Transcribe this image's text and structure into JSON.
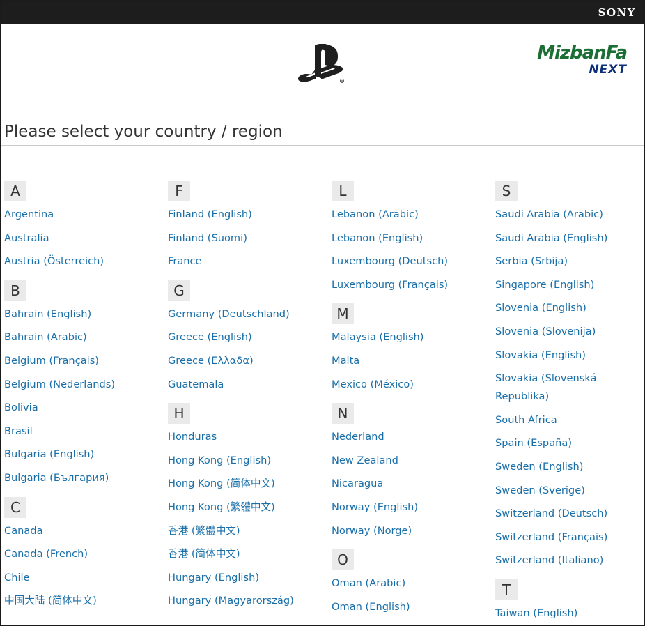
{
  "header": {
    "sony": "SONY"
  },
  "brand": {
    "line1": "MizbanFa",
    "line2": "NEXT"
  },
  "title": "Please select your country / region",
  "columns": [
    {
      "groups": [
        {
          "letter": "A",
          "items": [
            "Argentina",
            "Australia",
            "Austria (Österreich)"
          ]
        },
        {
          "letter": "B",
          "items": [
            "Bahrain (English)",
            "Bahrain (Arabic)",
            "Belgium (Français)",
            "Belgium (Nederlands)",
            "Bolivia",
            "Brasil",
            "Bulgaria (English)",
            "Bulgaria (България)"
          ]
        },
        {
          "letter": "C",
          "items": [
            "Canada",
            "Canada (French)",
            "Chile",
            "中国大陆 (简体中文)"
          ]
        }
      ]
    },
    {
      "groups": [
        {
          "letter": "F",
          "items": [
            "Finland (English)",
            "Finland (Suomi)",
            "France"
          ]
        },
        {
          "letter": "G",
          "items": [
            "Germany (Deutschland)",
            "Greece (English)",
            "Greece (Ελλαδα)",
            "Guatemala"
          ]
        },
        {
          "letter": "H",
          "items": [
            "Honduras",
            "Hong Kong (English)",
            "Hong Kong (简体中文)",
            "Hong Kong (繁體中文)",
            "香港 (繁體中文)",
            "香港 (简体中文)",
            "Hungary (English)",
            "Hungary (Magyarország)"
          ]
        }
      ]
    },
    {
      "groups": [
        {
          "letter": "L",
          "items": [
            "Lebanon (Arabic)",
            "Lebanon (English)",
            "Luxembourg (Deutsch)",
            "Luxembourg (Français)"
          ]
        },
        {
          "letter": "M",
          "items": [
            "Malaysia (English)",
            "Malta",
            "Mexico (México)"
          ]
        },
        {
          "letter": "N",
          "items": [
            "Nederland",
            "New Zealand",
            "Nicaragua",
            "Norway (English)",
            "Norway (Norge)"
          ]
        },
        {
          "letter": "O",
          "items": [
            "Oman (Arabic)",
            "Oman (English)"
          ]
        }
      ]
    },
    {
      "groups": [
        {
          "letter": "S",
          "items": [
            "Saudi Arabia (Arabic)",
            "Saudi Arabia (English)",
            "Serbia (Srbija)",
            "Singapore (English)",
            "Slovenia (English)",
            "Slovenia (Slovenija)",
            "Slovakia (English)",
            "Slovakia (Slovenská Republika)",
            "South Africa",
            "Spain (España)",
            "Sweden (English)",
            "Sweden (Sverige)",
            "Switzerland (Deutsch)",
            "Switzerland (Français)",
            "Switzerland (Italiano)"
          ]
        },
        {
          "letter": "T",
          "items": [
            "Taiwan (English)"
          ]
        }
      ]
    }
  ],
  "colors": {
    "link": "#1a6fa8",
    "topbar": "#1d1d1d",
    "letter_bg": "#eaeaea"
  }
}
